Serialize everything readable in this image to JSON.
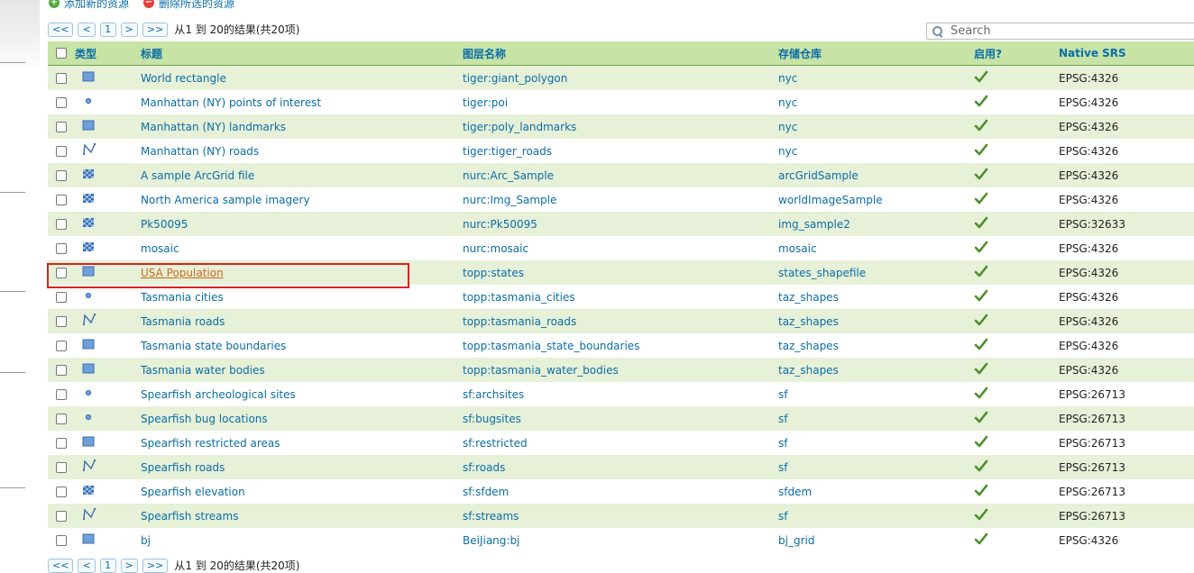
{
  "actions": {
    "add_label": "添加新的资源",
    "remove_label": "删除所选的资源"
  },
  "pager": {
    "first": "<<",
    "prev": "<",
    "page": "1",
    "next": ">",
    "last": ">>",
    "info": "从1 到 20的结果(共20项)"
  },
  "search": {
    "placeholder": "Search",
    "value": ""
  },
  "table": {
    "headers": {
      "type": "类型",
      "title": "标题",
      "name": "图层名称",
      "store": "存储仓库",
      "enabled": "启用?",
      "srs": "Native SRS"
    },
    "rows": [
      {
        "type": "polygon",
        "title": "World rectangle",
        "name": "tiger:giant_polygon",
        "store": "nyc",
        "enabled": true,
        "srs": "EPSG:4326"
      },
      {
        "type": "point",
        "title": "Manhattan (NY) points of interest",
        "name": "tiger:poi",
        "store": "nyc",
        "enabled": true,
        "srs": "EPSG:4326"
      },
      {
        "type": "polygon",
        "title": "Manhattan (NY) landmarks",
        "name": "tiger:poly_landmarks",
        "store": "nyc",
        "enabled": true,
        "srs": "EPSG:4326"
      },
      {
        "type": "line",
        "title": "Manhattan (NY) roads",
        "name": "tiger:tiger_roads",
        "store": "nyc",
        "enabled": true,
        "srs": "EPSG:4326"
      },
      {
        "type": "raster",
        "title": "A sample ArcGrid file",
        "name": "nurc:Arc_Sample",
        "store": "arcGridSample",
        "enabled": true,
        "srs": "EPSG:4326"
      },
      {
        "type": "raster",
        "title": "North America sample imagery",
        "name": "nurc:Img_Sample",
        "store": "worldImageSample",
        "enabled": true,
        "srs": "EPSG:4326"
      },
      {
        "type": "raster",
        "title": "Pk50095",
        "name": "nurc:Pk50095",
        "store": "img_sample2",
        "enabled": true,
        "srs": "EPSG:32633"
      },
      {
        "type": "raster",
        "title": "mosaic",
        "name": "nurc:mosaic",
        "store": "mosaic",
        "enabled": true,
        "srs": "EPSG:4326"
      },
      {
        "type": "polygon",
        "title": "USA Population",
        "name": "topp:states",
        "store": "states_shapefile",
        "enabled": true,
        "srs": "EPSG:4326",
        "highlighted": true
      },
      {
        "type": "point",
        "title": "Tasmania cities",
        "name": "topp:tasmania_cities",
        "store": "taz_shapes",
        "enabled": true,
        "srs": "EPSG:4326"
      },
      {
        "type": "line",
        "title": "Tasmania roads",
        "name": "topp:tasmania_roads",
        "store": "taz_shapes",
        "enabled": true,
        "srs": "EPSG:4326"
      },
      {
        "type": "polygon",
        "title": "Tasmania state boundaries",
        "name": "topp:tasmania_state_boundaries",
        "store": "taz_shapes",
        "enabled": true,
        "srs": "EPSG:4326"
      },
      {
        "type": "polygon",
        "title": "Tasmania water bodies",
        "name": "topp:tasmania_water_bodies",
        "store": "taz_shapes",
        "enabled": true,
        "srs": "EPSG:4326"
      },
      {
        "type": "point",
        "title": "Spearfish archeological sites",
        "name": "sf:archsites",
        "store": "sf",
        "enabled": true,
        "srs": "EPSG:26713"
      },
      {
        "type": "point",
        "title": "Spearfish bug locations",
        "name": "sf:bugsites",
        "store": "sf",
        "enabled": true,
        "srs": "EPSG:26713"
      },
      {
        "type": "polygon",
        "title": "Spearfish restricted areas",
        "name": "sf:restricted",
        "store": "sf",
        "enabled": true,
        "srs": "EPSG:26713"
      },
      {
        "type": "line",
        "title": "Spearfish roads",
        "name": "sf:roads",
        "store": "sf",
        "enabled": true,
        "srs": "EPSG:26713"
      },
      {
        "type": "raster",
        "title": "Spearfish elevation",
        "name": "sf:sfdem",
        "store": "sfdem",
        "enabled": true,
        "srs": "EPSG:26713"
      },
      {
        "type": "line",
        "title": "Spearfish streams",
        "name": "sf:streams",
        "store": "sf",
        "enabled": true,
        "srs": "EPSG:26713"
      },
      {
        "type": "polygon",
        "title": "bj",
        "name": "BeiJiang:bj",
        "store": "bj_grid",
        "enabled": true,
        "srs": "EPSG:4326"
      }
    ]
  },
  "colors": {
    "link": "#0b6da7",
    "header_bg": "#c7e3a6",
    "row_alt_bg": "#e6f1d8",
    "highlight_border": "#d9231f",
    "highlight_link": "#d0661a",
    "check": "#4a8f2a"
  }
}
